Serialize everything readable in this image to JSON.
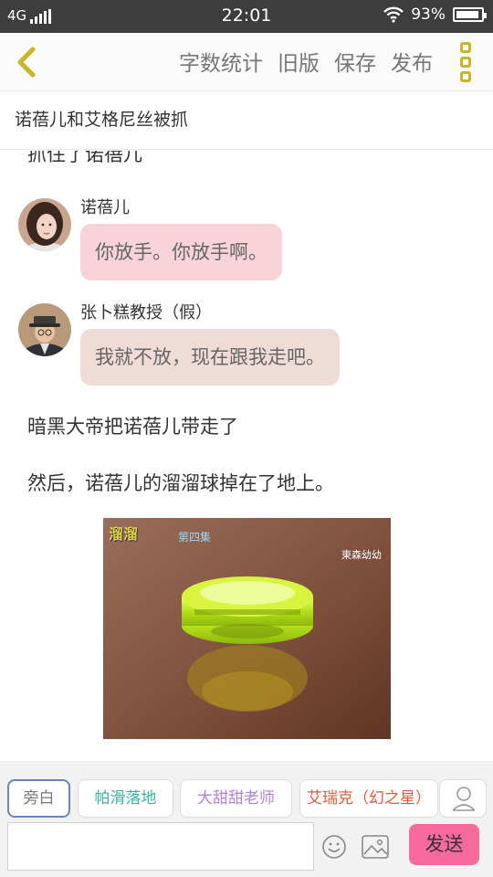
{
  "status_bar": {
    "network": "4G",
    "time": "22:01",
    "battery": "93%",
    "battery_level": 0.93
  },
  "toolbar": {
    "actions": [
      "字数统计",
      "旧版",
      "保存",
      "发布"
    ]
  },
  "story_title": "诺蓓儿和艾格尼丝被抓",
  "content": {
    "cut_off_text": "抓住了诺蓓儿",
    "messages": [
      {
        "speaker": "诺蓓儿",
        "text": "你放手。你放手啊。"
      },
      {
        "speaker": "张卜糕教授（假）",
        "text": "我就不放，现在跟我走吧。"
      }
    ],
    "narration": [
      "暗黑大帝把诺蓓儿带走了",
      "然后，诺蓓儿的溜溜球掉在了地上。"
    ],
    "image": {
      "logo_text": "溜溜",
      "episode_text": "第四集",
      "channel_text": "東森幼幼"
    }
  },
  "characters": [
    "旁白",
    "帕滑落地",
    "大甜甜老师",
    "艾瑞克（幻之星）"
  ],
  "input": {
    "value": "",
    "placeholder": ""
  },
  "send_label": "发送",
  "colors": {
    "accent": "#f96a9c",
    "bubble_1": "#f8d3d9",
    "bubble_2": "#f0dcd7",
    "status_bar": "#3d3d3d",
    "icon_gold": "#c9b52a"
  }
}
